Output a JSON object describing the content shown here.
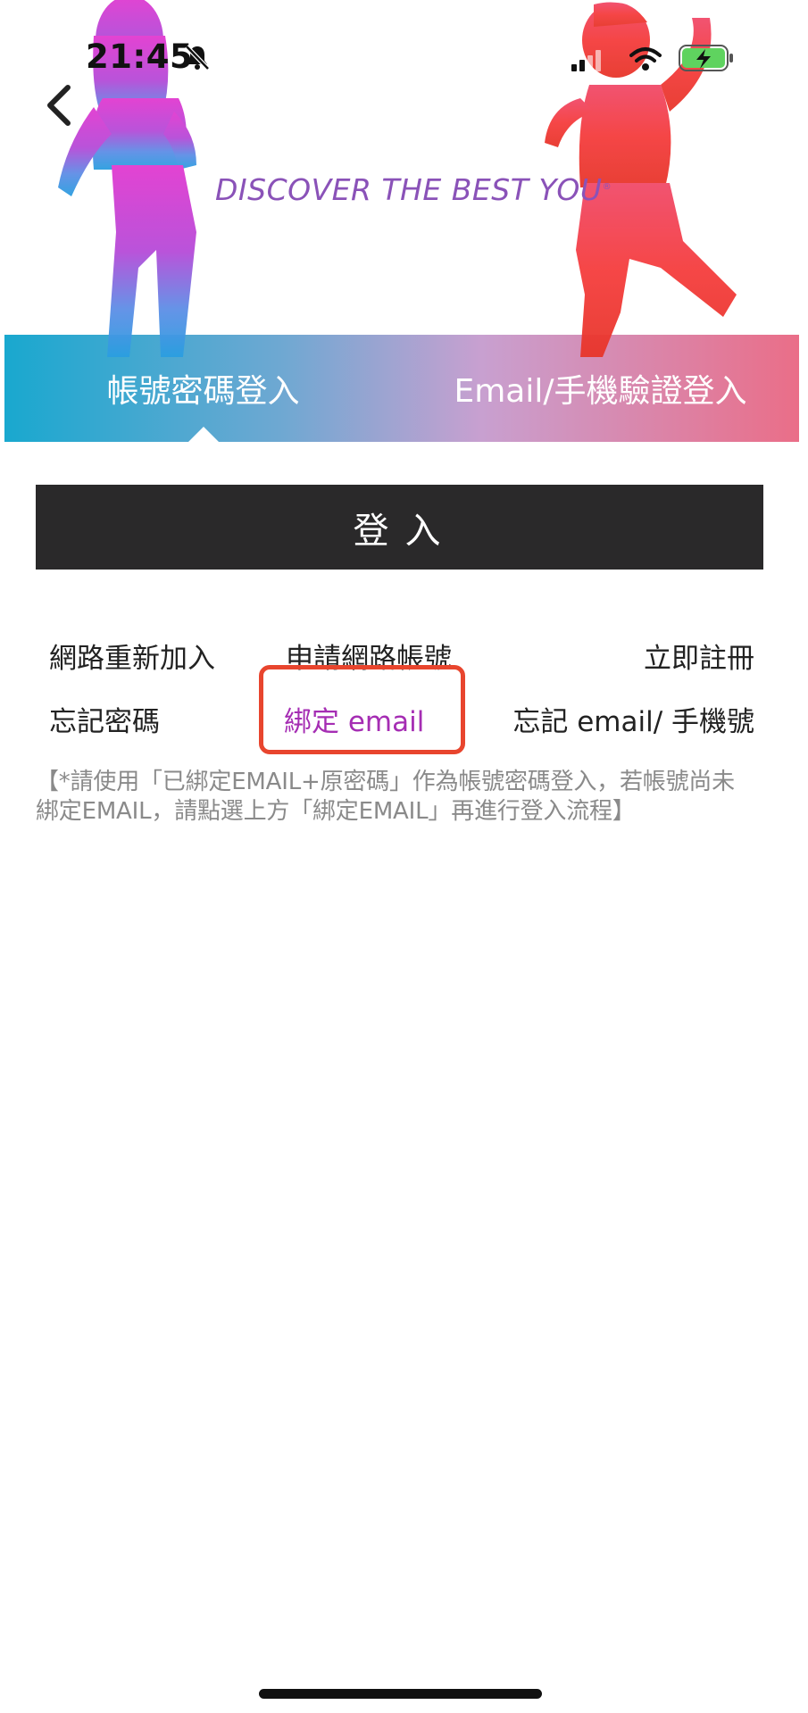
{
  "status_bar": {
    "time": "21:45",
    "icons": [
      "bell-slash-icon",
      "cellular-signal-icon",
      "wifi-icon",
      "battery-charging-icon"
    ]
  },
  "header": {
    "back_icon": "chevron-left-icon",
    "tagline": "DISCOVER THE BEST YOU",
    "tagline_mark": "®"
  },
  "tabs": [
    {
      "label": "帳號密碼登入",
      "active": true
    },
    {
      "label": "Email/手機驗證登入",
      "active": false
    }
  ],
  "login_button_label": "登入",
  "links": {
    "rejoin": "網路重新加入",
    "apply_account": "申請網路帳號",
    "register_now": "立即註冊",
    "forgot_password": "忘記密碼",
    "bind_email": "綁定 email",
    "forgot_email_phone": "忘記 email/ 手機號"
  },
  "notice": {
    "line1": "【*請使用「已綁定EMAIL+原密碼」作為帳號密碼登入，若帳號尚未",
    "line2": "綁定EMAIL，請點選上方「綁定EMAIL」再進行登入流程】"
  },
  "colors": {
    "highlight_link": "#a52db3",
    "callout_border": "#e8452e",
    "login_button_bg": "#2a292a",
    "tab_gradient": [
      "#1aa9cf",
      "#c79fd0",
      "#e9718a"
    ],
    "tagline": "#8a52b8"
  }
}
